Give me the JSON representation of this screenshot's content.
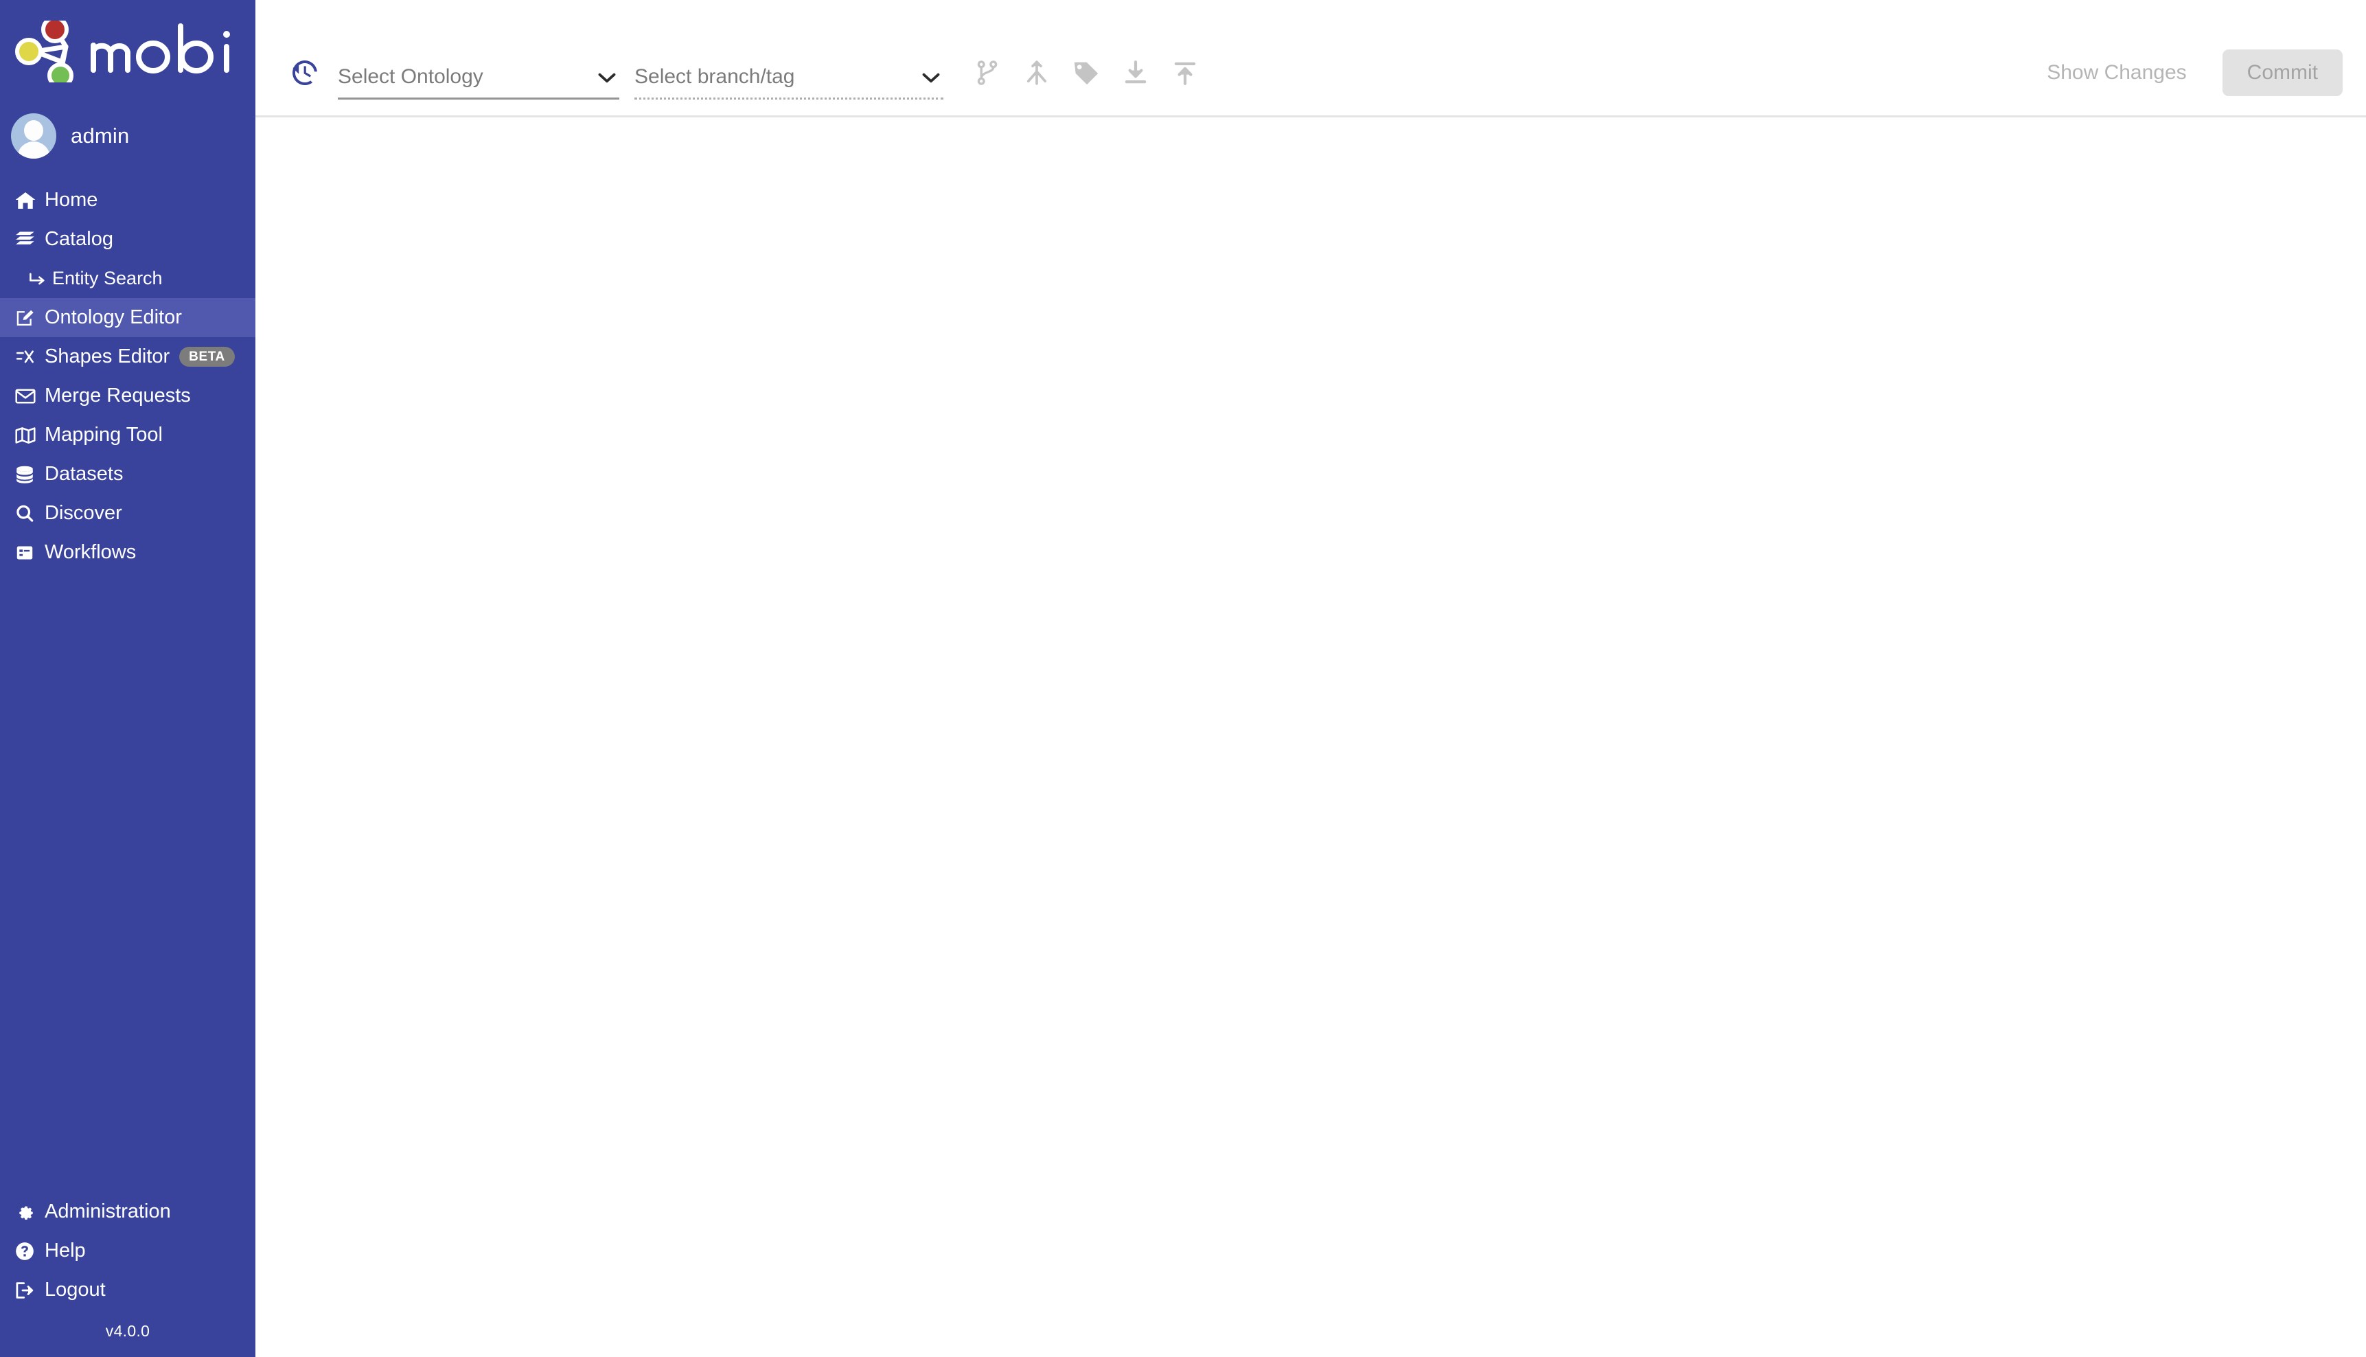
{
  "brand": {
    "name": "mobi",
    "logo_icon": "mobi-graph-logo",
    "logo_colors": {
      "node_red": "#b5302c",
      "node_yellow": "#dfd748",
      "node_green": "#74bf55"
    }
  },
  "theme": {
    "sidebar_bg": "#39439b",
    "sidebar_active_bg": "#5059ae",
    "accent_blue": "#39439b",
    "disabled_grey": "#c4c4c4",
    "badge_grey": "#7c7c7c",
    "commit_bg": "#e2e2e2"
  },
  "user": {
    "name": "admin",
    "avatar_icon": "user-avatar-icon"
  },
  "sidebar": {
    "items": [
      {
        "label": "Home",
        "icon": "home-icon",
        "active": false,
        "sub": false
      },
      {
        "label": "Catalog",
        "icon": "catalog-book-icon",
        "active": false,
        "sub": false
      },
      {
        "label": "Entity Search",
        "icon": "arrow-return-icon",
        "active": false,
        "sub": true
      },
      {
        "label": "Ontology Editor",
        "icon": "edit-square-icon",
        "active": true,
        "sub": false
      },
      {
        "label": "Shapes Editor",
        "icon": "shapes-filter-icon",
        "active": false,
        "sub": false,
        "badge": "BETA"
      },
      {
        "label": "Merge Requests",
        "icon": "envelope-icon",
        "active": false,
        "sub": false
      },
      {
        "label": "Mapping Tool",
        "icon": "map-icon",
        "active": false,
        "sub": false
      },
      {
        "label": "Datasets",
        "icon": "database-icon",
        "active": false,
        "sub": false
      },
      {
        "label": "Discover",
        "icon": "search-icon",
        "active": false,
        "sub": false
      },
      {
        "label": "Workflows",
        "icon": "workflow-checklist-icon",
        "active": false,
        "sub": false
      }
    ],
    "bottom_items": [
      {
        "label": "Administration",
        "icon": "gear-icon"
      },
      {
        "label": "Help",
        "icon": "question-circle-icon"
      },
      {
        "label": "Logout",
        "icon": "logout-icon"
      }
    ],
    "version": "v4.0.0"
  },
  "toolbar": {
    "history_icon": "history-clock-icon",
    "ontology_select": {
      "name": "ontology-select",
      "value": "",
      "placeholder": "Select Ontology",
      "disabled": false
    },
    "branch_select": {
      "name": "branch-tag-select",
      "value": "",
      "placeholder": "Select branch/tag",
      "disabled": true
    },
    "actions": [
      {
        "name": "create-branch-button",
        "icon": "branch-icon",
        "disabled": true
      },
      {
        "name": "merge-branches-button",
        "icon": "merge-icon",
        "disabled": true
      },
      {
        "name": "create-tag-button",
        "icon": "tag-icon",
        "disabled": true
      },
      {
        "name": "download-ontology-button",
        "icon": "download-icon",
        "disabled": true
      },
      {
        "name": "upload-changes-button",
        "icon": "upload-icon",
        "disabled": true
      }
    ],
    "show_changes_label": "Show Changes",
    "commit_label": "Commit",
    "show_changes_disabled": true,
    "commit_disabled": true
  },
  "main": {
    "content": ""
  }
}
